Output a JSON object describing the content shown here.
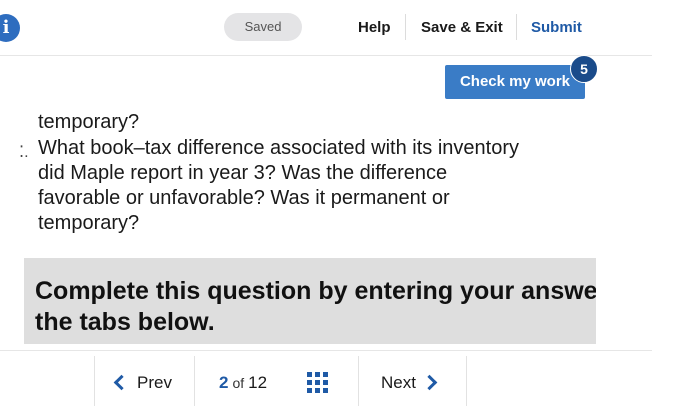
{
  "header": {
    "info_icon_glyph": "i",
    "saved_label": "Saved",
    "help_label": "Help",
    "save_exit_label": "Save & Exit",
    "submit_label": "Submit"
  },
  "check_work": {
    "label": "Check my work",
    "badge_count": "5"
  },
  "question": {
    "line1": "temporary?",
    "marker": "⁚.",
    "line2": "What book–tax difference associated with its inventory",
    "line3": "did Maple report in year 3? Was the difference",
    "line4": "favorable or unfavorable? Was it permanent or",
    "line5": "temporary?"
  },
  "instruction_panel": {
    "text": "Complete this question by entering your answers in the tabs below."
  },
  "pagination": {
    "prev_label": "Prev",
    "current_page": "2",
    "of_label": "of",
    "total_pages": "12",
    "next_label": "Next"
  },
  "colors": {
    "accent": "#1f5aa6",
    "button": "#3a7cc6",
    "badge": "#1a4b8a",
    "panel_bg": "#dedede"
  },
  "icons": [
    "info-icon",
    "chevron-left-icon",
    "grid-icon",
    "chevron-right-icon"
  ]
}
